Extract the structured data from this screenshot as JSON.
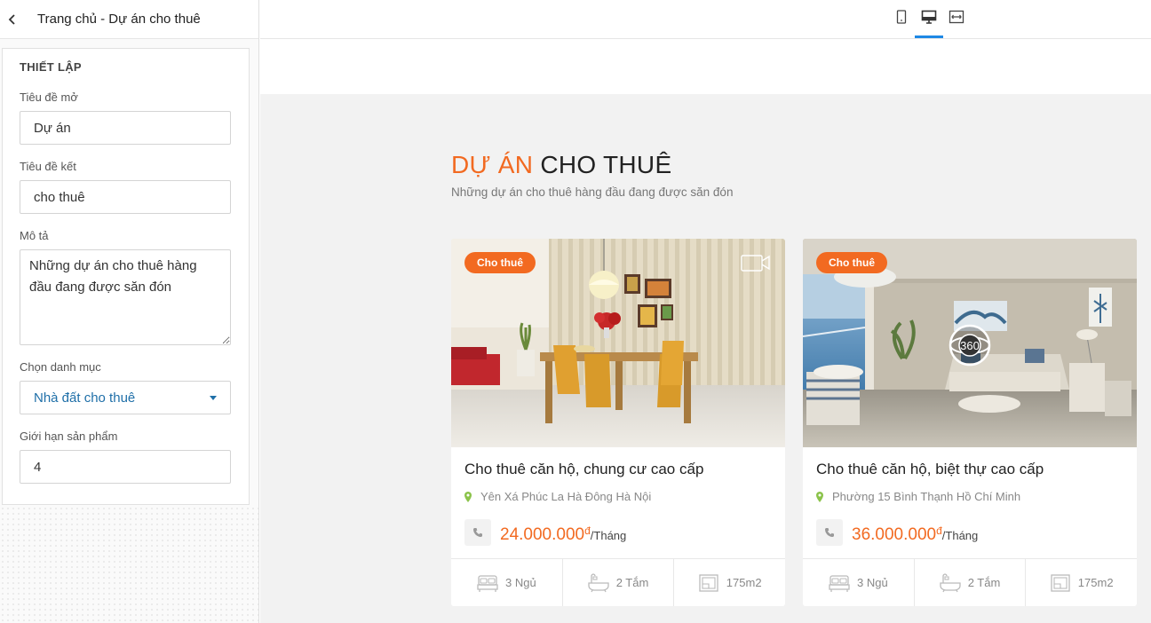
{
  "header": {
    "title": "Trang chủ - Dự án cho thuê"
  },
  "settings": {
    "heading": "THIẾT LẬP",
    "open_title_label": "Tiêu đề mở",
    "open_title_value": "Dự án",
    "close_title_label": "Tiêu đề kết",
    "close_title_value": "cho thuê",
    "description_label": "Mô tả",
    "description_value": "Những dự án cho thuê hàng đầu đang được săn đón",
    "category_label": "Chọn danh mục",
    "category_value": "Nhà đất cho thuê",
    "limit_label": "Giới hạn sản phẩm",
    "limit_value": "4"
  },
  "toolbar": {
    "views": [
      "mobile",
      "desktop",
      "fullwidth"
    ],
    "active_view": "desktop"
  },
  "preview": {
    "title_accent": "DỰ ÁN",
    "title_main": "CHO THUÊ",
    "subtitle": "Những dự án cho thuê hàng đầu đang được săn đón",
    "cards": [
      {
        "badge": "Cho thuê",
        "media_icon": "video-icon",
        "name": "Cho thuê căn hộ, chung cư cao cấp",
        "location": "Yên Xá Phúc La Hà Đông Hà Nội",
        "price": "24.000.000",
        "currency": "đ",
        "per": "/Tháng",
        "bedrooms": "3 Ngủ",
        "bathrooms": "2 Tắm",
        "area": "175m2"
      },
      {
        "badge": "Cho thuê",
        "media_icon": "360-view-icon",
        "media_label": "360",
        "name": "Cho thuê căn hộ, biệt thự cao cấp",
        "location": "Phường 15 Bình Thạnh Hồ Chí Minh",
        "price": "36.000.000",
        "currency": "đ",
        "per": "/Tháng",
        "bedrooms": "3 Ngủ",
        "bathrooms": "2 Tắm",
        "area": "175m2"
      }
    ]
  },
  "colors": {
    "accent": "#f26a21",
    "link": "#1f6fa8",
    "active_tab": "#1e88e5",
    "location_pin": "#8bc34a"
  }
}
